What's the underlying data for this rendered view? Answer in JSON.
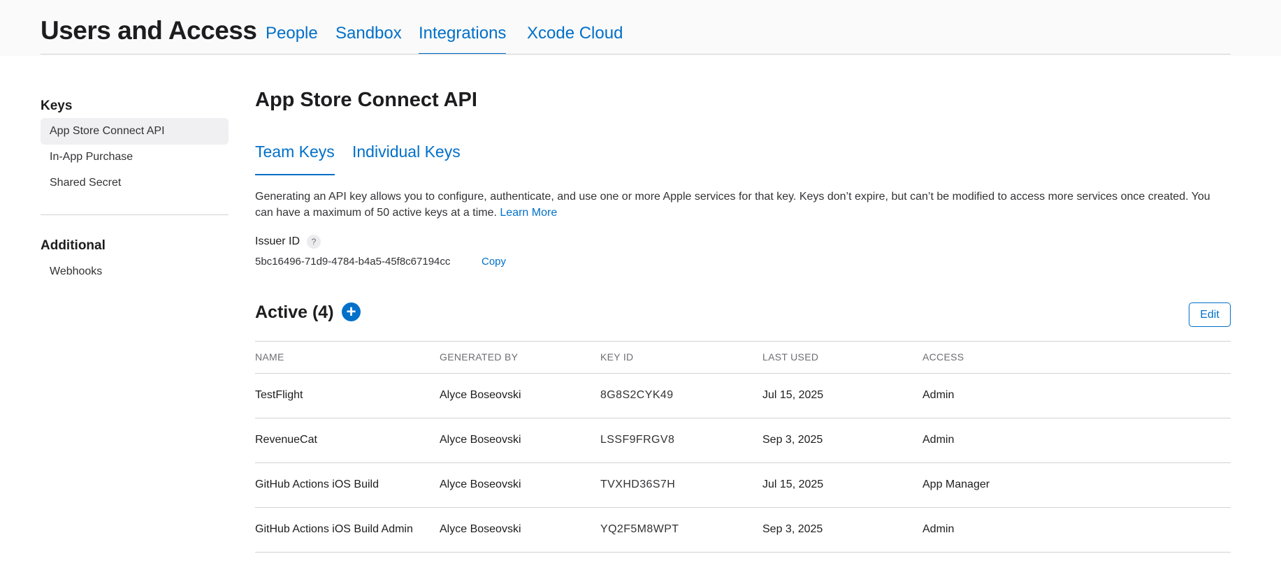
{
  "header": {
    "title": "Users and Access",
    "tabs": [
      {
        "label": "People",
        "active": false
      },
      {
        "label": "Sandbox",
        "active": false
      },
      {
        "label": "Integrations",
        "active": true
      },
      {
        "label": "Xcode Cloud",
        "active": false
      }
    ]
  },
  "sidebar": {
    "keys_heading": "Keys",
    "keys_items": [
      {
        "label": "App Store Connect API",
        "selected": true
      },
      {
        "label": "In-App Purchase",
        "selected": false
      },
      {
        "label": "Shared Secret",
        "selected": false
      }
    ],
    "additional_heading": "Additional",
    "additional_items": [
      {
        "label": "Webhooks",
        "selected": false
      }
    ]
  },
  "main": {
    "title": "App Store Connect API",
    "tabs": [
      {
        "label": "Team Keys",
        "active": true
      },
      {
        "label": "Individual Keys",
        "active": false
      }
    ],
    "description": "Generating an API key allows you to configure, authenticate, and use one or more Apple services for that key. Keys don’t expire, but can’t be modified to access more services once created. You can have a maximum of 50 active keys at a time.",
    "learn_more": "Learn More",
    "issuer_label": "Issuer ID",
    "issuer_help": "?",
    "issuer_id": "5bc16496-71d9-4784-b4a5-45f8c67194cc",
    "copy_label": "Copy",
    "active_title": "Active (4)",
    "add_symbol": "+",
    "edit_label": "Edit",
    "table": {
      "columns": [
        "NAME",
        "GENERATED BY",
        "KEY ID",
        "LAST USED",
        "ACCESS"
      ],
      "rows": [
        {
          "name": "TestFlight",
          "generated_by": "Alyce Boseovski",
          "key_id": "8G8S2CYK49",
          "last_used": "Jul 15, 2025",
          "access": "Admin"
        },
        {
          "name": "RevenueCat",
          "generated_by": "Alyce Boseovski",
          "key_id": "LSSF9FRGV8",
          "last_used": "Sep 3, 2025",
          "access": "Admin"
        },
        {
          "name": "GitHub Actions iOS Build",
          "generated_by": "Alyce Boseovski",
          "key_id": "TVXHD36S7H",
          "last_used": "Jul 15, 2025",
          "access": "App Manager"
        },
        {
          "name": "GitHub Actions iOS Build Admin",
          "generated_by": "Alyce Boseovski",
          "key_id": "YQ2F5M8WPT",
          "last_used": "Sep 3, 2025",
          "access": "Admin"
        }
      ]
    }
  },
  "colors": {
    "accent": "#0070c9",
    "text": "#1d1d1f",
    "secondary_text": "#6e6e73",
    "divider": "#d2d2d7",
    "selected_bg": "#f0f0f2"
  },
  "icons": {
    "help": "question-circle-icon",
    "add": "plus-circle-icon"
  }
}
